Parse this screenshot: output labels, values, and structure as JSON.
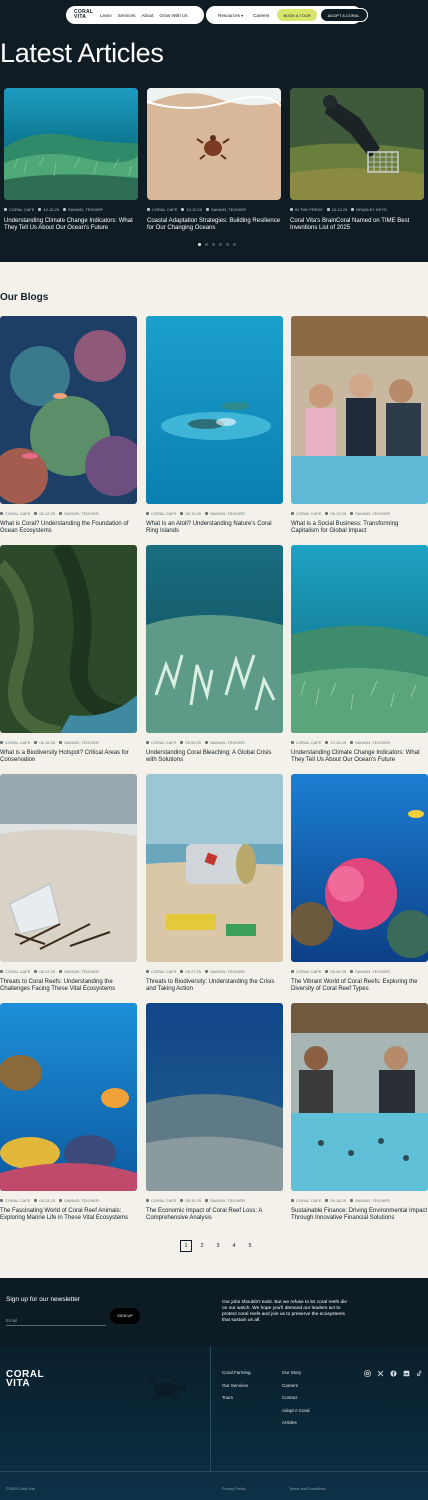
{
  "nav": {
    "logo_line1": "CORAL",
    "logo_line2": "VITA",
    "links": [
      "Learn",
      "Services",
      "About",
      "Grow With Us"
    ],
    "resources": "Resources",
    "careers": "Careers",
    "book_tour": "BOOK A TOUR",
    "adopt": "ADOPT A CORAL"
  },
  "latest": {
    "title": "Latest Articles",
    "slides": [
      {
        "category": "CORAL CAFE",
        "date": "10.15.25",
        "author": "SAMUEL TEICHER",
        "title": "Understanding Climate Change Indicators: What They Tell Us About Our Ocean's Future"
      },
      {
        "category": "CORAL CAFE",
        "date": "10.10.25",
        "author": "SAMUEL TEICHER",
        "title": "Coastal Adaptation Strategies: Building Resilience for Our Changing Oceans"
      },
      {
        "category": "IN THE PRESS",
        "date": "10.14.25",
        "author": "BRADLEY KEYS",
        "title": "Coral Vita's BrainCoral Named on TIME Best Inventions List of 2025"
      }
    ]
  },
  "blogs": {
    "title": "Our Blogs",
    "posts": [
      {
        "category": "CORAL CAFE",
        "date": "06.12.25",
        "author": "SAMUEL TEICHER",
        "title": "What is Coral? Understanding the Foundation of Ocean Ecosystems"
      },
      {
        "category": "CORAL CAFE",
        "date": "06.10.25",
        "author": "SAMUEL TEICHER",
        "title": "What Is an Atoll? Understanding Nature's Coral Ring Islands"
      },
      {
        "category": "CORAL CAFE",
        "date": "06.19.25",
        "author": "SAMUEL TEICHER",
        "title": "What is a Social Business: Transforming Capitalism for Global Impact"
      },
      {
        "category": "CORAL CAFE",
        "date": "06.16.25",
        "author": "SAMUEL TEICHER",
        "title": "What is a Biodiversity Hotspot? Critical Areas for Conservation"
      },
      {
        "category": "CORAL CAFE",
        "date": "05.06.25",
        "author": "SAMUEL TEICHER",
        "title": "Understanding Coral Bleaching: A Global Crisis with Solutions"
      },
      {
        "category": "CORAL CAFE",
        "date": "10.15.25",
        "author": "SAMUEL TEICHER",
        "title": "Understanding Climate Change Indicators: What They Tell Us About Our Ocean's Future"
      },
      {
        "category": "CORAL CAFE",
        "date": "06.22.25",
        "author": "SAMUEL TEICHER",
        "title": "Threats to Coral Reefs: Understanding the Challenges Facing These Vital Ecosystems"
      },
      {
        "category": "CORAL CAFE",
        "date": "05.27.25",
        "author": "SAMUEL TEICHER",
        "title": "Threats to Biodiversity: Understanding the Crisis and Taking Action"
      },
      {
        "category": "CORAL CAFE",
        "date": "05.06.25",
        "author": "SAMUEL TEICHER",
        "title": "The Vibrant World of Coral Reefs: Exploring the Diversity of Coral Reef Types"
      },
      {
        "category": "CORAL CAFE",
        "date": "05.23.25",
        "author": "SAMUEL TEICHER",
        "title": "The Fascinating World of Coral Reef Animals: Exploring Marine Life in These Vital Ecosystems"
      },
      {
        "category": "CORAL CAFE",
        "date": "05.30.25",
        "author": "SAMUEL TEICHER",
        "title": "The Economic Impact of Coral Reef Loss: A Comprehensive Analysis"
      },
      {
        "category": "CORAL CAFE",
        "date": "09.18.25",
        "author": "SAMUEL TEICHER",
        "title": "Sustainable Finance: Driving Environmental Impact Through Innovative Financial Solutions"
      }
    ]
  },
  "pagination": {
    "pages": [
      "1",
      "2",
      "3",
      "4",
      "5"
    ],
    "current": "1"
  },
  "newsletter": {
    "title": "Sign up for our newsletter",
    "email_placeholder": "Email",
    "button": "SIGN UP",
    "blurb": "Our jobs shouldn't exist. But we refuse to let coral reefs die on our watch. We hope you'll demand our leaders act to protect coral reefs and join us to preserve the ecosystems that sustain us all."
  },
  "footer": {
    "logo_line1": "CORAL",
    "logo_line2": "VITA",
    "col1": [
      "Coral Farming",
      "Our Services",
      "Tours"
    ],
    "col2": [
      "Our Story",
      "Careers",
      "Contact",
      "Adopt A Coral",
      "Articles"
    ],
    "social_icons": [
      "instagram-icon",
      "x-icon",
      "facebook-icon",
      "linkedin-icon",
      "tiktok-icon"
    ],
    "copyright": "©2025 Coral Vita",
    "privacy": "Privacy Policy",
    "terms": "Terms and Conditions"
  },
  "colors": {
    "dark": "#0f1c24",
    "accent_yellow": "#d8e46a",
    "paper": "#f3f1ea"
  }
}
